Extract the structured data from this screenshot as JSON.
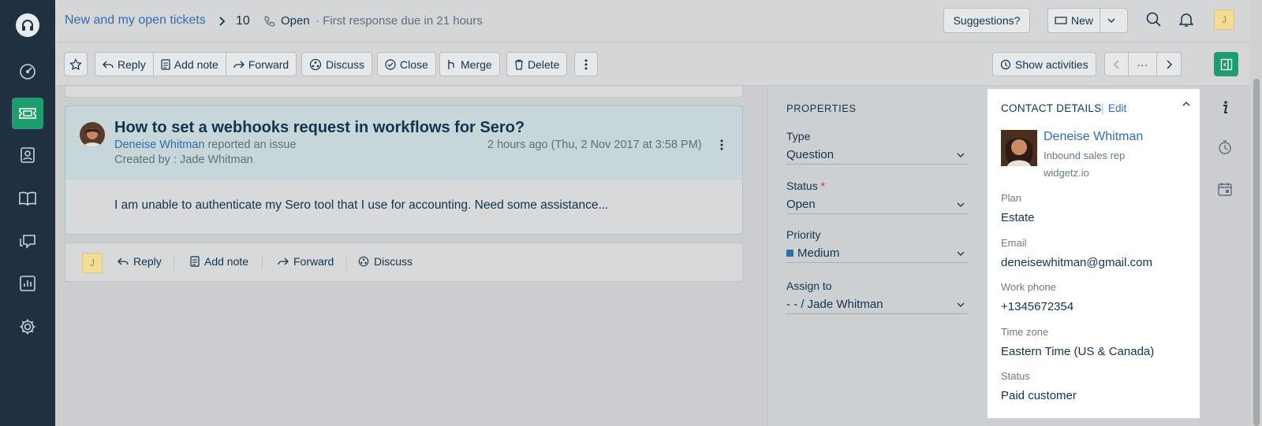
{
  "header": {
    "breadcrumb": "New and my open tickets",
    "ticket_id": "10",
    "status": "Open",
    "due_text": "· First response due in 21 hours",
    "suggestions_label": "Suggestions?",
    "new_label": "New",
    "user_initial": "J"
  },
  "toolbar": {
    "reply": "Reply",
    "add_note": "Add note",
    "forward": "Forward",
    "discuss": "Discuss",
    "close": "Close",
    "merge": "Merge",
    "delete": "Delete",
    "show_activities": "Show activities",
    "more": "···"
  },
  "ticket": {
    "subject": "How to set a webhooks request in workflows for Sero?",
    "requester": "Deneise Whitman",
    "reported_text": " reported an issue",
    "created_by": "Created by : Jade Whitman",
    "time": "2 hours ago (Thu, 2 Nov 2017 at 3:58 PM)",
    "body": "I am unable to authenticate my Sero tool that I use for accounting. Need some assistance..."
  },
  "reply_bar": {
    "initial": "J",
    "reply": "Reply",
    "add_note": "Add note",
    "forward": "Forward",
    "discuss": "Discuss"
  },
  "properties": {
    "title": "PROPERTIES",
    "type_label": "Type",
    "type_value": "Question",
    "status_label": "Status",
    "status_required": "*",
    "status_value": "Open",
    "priority_label": "Priority",
    "priority_value": "Medium",
    "priority_color": "#2c6fb6",
    "assign_label": "Assign to",
    "assign_value": "- - / Jade Whitman"
  },
  "contact": {
    "title": "CONTACT DETAILS",
    "pipe": "|",
    "edit": "Edit",
    "name": "Deneise Whitman",
    "role": "Inbound sales rep",
    "company": "widgetz.io",
    "plan_label": "Plan",
    "plan": "Estate",
    "email_label": "Email",
    "email": "deneisewhitman@gmail.com",
    "phone_label": "Work phone",
    "phone": "+1345672354",
    "tz_label": "Time zone",
    "tz": "Eastern Time (US & Canada)",
    "status_label": "Status",
    "status": "Paid customer"
  },
  "colors": {
    "accent": "#2c6fb6",
    "brand_green": "#1e9e6e",
    "nav_bg": "#1f3140"
  }
}
